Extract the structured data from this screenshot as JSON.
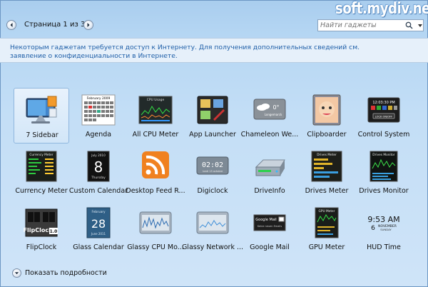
{
  "header": {
    "page_label": "Страница 1 из 3",
    "search_placeholder": "Найти гаджеты",
    "watermark": "soft.mydiv.net"
  },
  "notice": {
    "text": "Некоторым гаджетам требуется доступ к Интернету. Для получения дополнительных сведений см. заявление о конфиденциальности в Интернете."
  },
  "gadgets": [
    {
      "label": "7 Sidebar",
      "selected": true
    },
    {
      "label": "Agenda"
    },
    {
      "label": "All CPU Meter"
    },
    {
      "label": "App Launcher"
    },
    {
      "label": "Chameleon We..."
    },
    {
      "label": "Clipboarder"
    },
    {
      "label": "Control System"
    },
    {
      "label": "Currency Meter"
    },
    {
      "label": "Custom Calendar"
    },
    {
      "label": "Desktop Feed R..."
    },
    {
      "label": "Digiclock"
    },
    {
      "label": "DriveInfo"
    },
    {
      "label": "Drives Meter"
    },
    {
      "label": "Drives Monitor"
    },
    {
      "label": "FlipClock"
    },
    {
      "label": "Glass Calendar"
    },
    {
      "label": "Glassy CPU Mo..."
    },
    {
      "label": "Glassy Network ..."
    },
    {
      "label": "Google Mail"
    },
    {
      "label": "GPU Meter"
    },
    {
      "label": "HUD Time"
    }
  ],
  "thumb_text": {
    "agenda_title": "February 2009",
    "cpu_title": "CPU Usage",
    "chameleon_temp": "0°",
    "chameleon_city": "Longemarck",
    "control_time": "12:03:30 PM",
    "control_lock": "LOCK ON/OFF",
    "currency_title": "Currency Meter",
    "calendar_month": "July 2010",
    "calendar_day": "8",
    "calendar_weekday": "Thursday",
    "digiclock_time": "02:02",
    "digiclock_date": "lundi 15  octobre",
    "drives_meter_title": "Drives Meter",
    "drives_monitor_title": "Drives Monitor",
    "flipclock_label": "FlipClock",
    "flipclock_version": "1.0",
    "glass_cal_month": "February",
    "glass_cal_day": "28",
    "glass_cal_year": "June 2011",
    "gmail_title": "Google Mail",
    "gmail_sub": "Keine neuen Emails",
    "gpu_title": "GPU Meter",
    "hud_time": "9:53 AM",
    "hud_day": "6",
    "hud_month": "NOVEMBER",
    "hud_weekday": "SUNDAY"
  },
  "footer": {
    "details_label": "Показать подробности"
  }
}
